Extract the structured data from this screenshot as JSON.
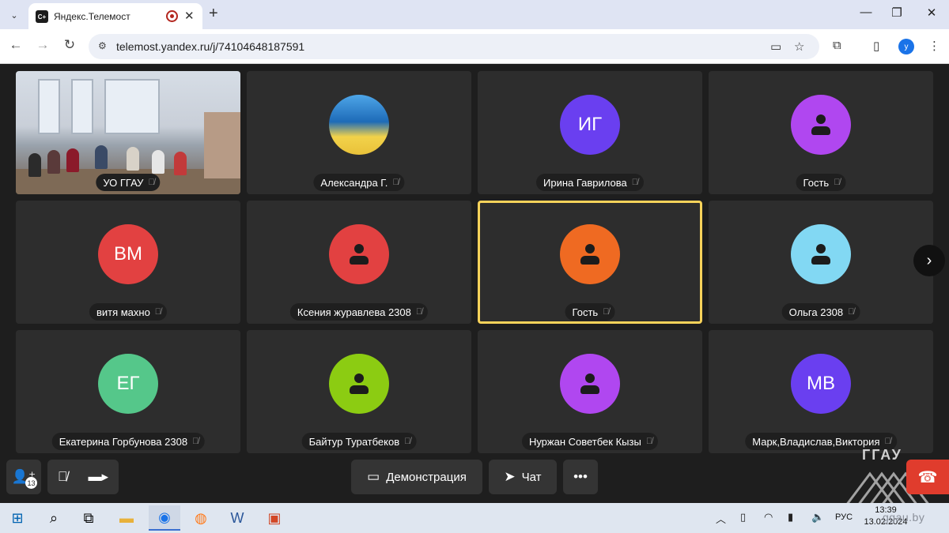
{
  "browser": {
    "tab_title": "Яндекс.Телемост",
    "favicon_label": "C+",
    "url": "telemost.yandex.ru/j/74104648187591",
    "profile_initial": "у"
  },
  "meeting": {
    "participants": [
      {
        "name": "УО ГГАУ",
        "type": "video"
      },
      {
        "name": "Александра Г.",
        "type": "photo"
      },
      {
        "name": "Ирина Гаврилова",
        "initials": "ИГ",
        "color": "#6a3ff0"
      },
      {
        "name": "Гость",
        "icon": "person-icon",
        "color": "#b047f0"
      },
      {
        "name": "витя махно",
        "initials": "ВМ",
        "color": "#e24141"
      },
      {
        "name": "Ксения журавлева 2308",
        "icon": "person-icon",
        "color": "#e24141"
      },
      {
        "name": "Гость",
        "icon": "person-icon",
        "color": "#ef6a22",
        "active": true
      },
      {
        "name": "Ольга 2308",
        "icon": "person-icon",
        "color": "#82d8f3"
      },
      {
        "name": "Екатерина Горбунова 2308",
        "initials": "ЕГ",
        "color": "#55c78a"
      },
      {
        "name": "Байтур Туратбеков",
        "icon": "person-icon",
        "color": "#8ccc12"
      },
      {
        "name": "Нуржан Советбек Кызы",
        "icon": "person-icon",
        "color": "#b047f0"
      },
      {
        "name": "Марк,Владислав,Виктория",
        "initials": "МВ",
        "color": "#6a3ff0"
      }
    ]
  },
  "controls": {
    "participants_count": "13",
    "demo_label": "Демонстрация",
    "chat_label": "Чат",
    "more_label": "•••"
  },
  "watermark": {
    "logo_text": "ГГАУ",
    "site": "ggau.by"
  },
  "taskbar": {
    "lang": "РУС",
    "time": "13:39",
    "date": "13.02.2024"
  }
}
